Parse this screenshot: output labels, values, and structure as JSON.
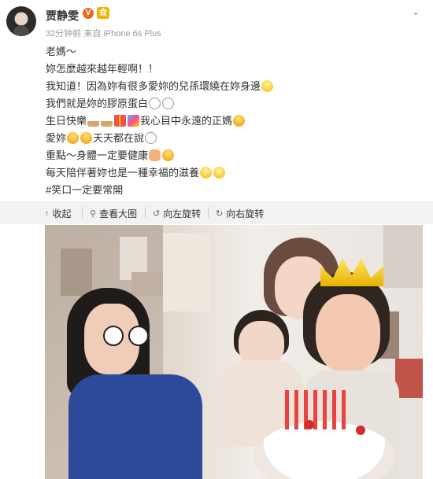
{
  "post": {
    "username": "贾静雯",
    "verified_badge": "V",
    "member_badge": "会",
    "time_ago": "32分钟前",
    "source": "来自 iPhone 6s Plus",
    "more_icon": "chevron-down-icon",
    "lines": [
      "老媽～",
      "妳怎麼越來越年輕啊！！",
      "我知道！因為妳有很多愛妳的兒孫環繞在妳身邊",
      "我們就是妳的膠原蛋白",
      "生日快樂",
      "我心目中永遠的正媽",
      "愛妳",
      "天天都在說",
      "重點～身體一定要健康",
      "每天陪伴著妳也是一種幸福的滋養",
      "#笑口一定要常開"
    ]
  },
  "toolbar": {
    "collapse": "收起",
    "view_large": "查看大图",
    "rotate_left": "向左旋转",
    "rotate_right": "向右旋转"
  },
  "colors": {
    "verified": "#e96a1e",
    "member": "#f5b400",
    "toolbar_bg": "#f2f2f2",
    "text": "#333333",
    "meta": "#999999"
  }
}
